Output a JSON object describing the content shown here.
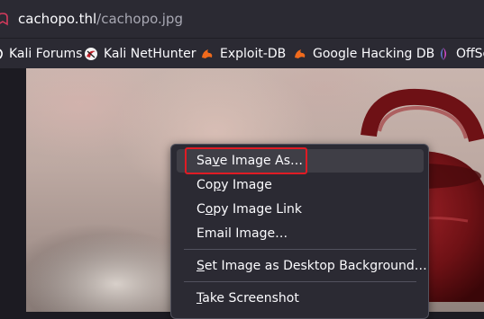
{
  "urlbar": {
    "host": "cachopo.thl",
    "path": "/cachopo.jpg"
  },
  "bookmarks": [
    {
      "label": "Kali Forums",
      "icon": "kali-dragon-icon"
    },
    {
      "label": "Kali NetHunter",
      "icon": "nethunter-icon"
    },
    {
      "label": "Exploit-DB",
      "icon": "exploit-db-icon"
    },
    {
      "label": "Google Hacking DB",
      "icon": "ghdb-icon"
    },
    {
      "label": "OffSe",
      "icon": "offsec-icon"
    }
  ],
  "context_menu": {
    "items": [
      {
        "pre": "Sa",
        "key": "v",
        "post": "e Image As…"
      },
      {
        "pre": "Co",
        "key": "p",
        "post": "y Image"
      },
      {
        "pre": "C",
        "key": "o",
        "post": "py Image Link"
      },
      {
        "pre": "Email Image…",
        "key": "",
        "post": ""
      },
      {
        "pre": "",
        "key": "S",
        "post": "et Image as Desktop Background…"
      },
      {
        "pre": "",
        "key": "T",
        "post": "ake Screenshot"
      }
    ]
  },
  "colors": {
    "toolbar": "#2b2a33",
    "menu_bg": "#2b2a33",
    "highlight_border": "#e01b24",
    "kettle_red": "#7a1418"
  }
}
